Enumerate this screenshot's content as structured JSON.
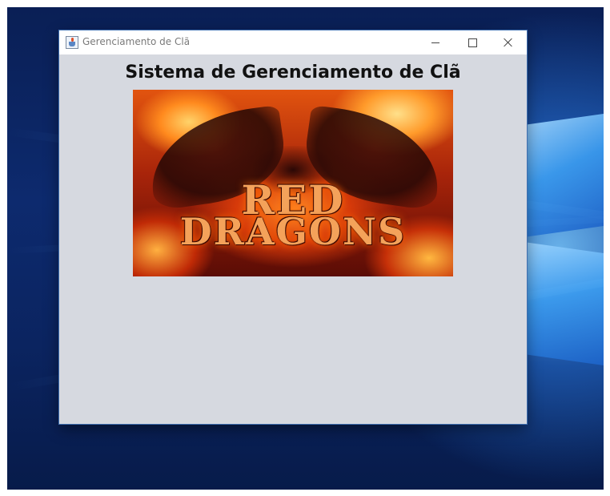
{
  "window": {
    "title": "Gerenciamento de Clã"
  },
  "main": {
    "heading": "Sistema de Gerenciamento de Clã",
    "banner": {
      "line1": "RED",
      "line2": "DRAGONS"
    }
  },
  "icons": {
    "app": "java-cup-icon",
    "minimize": "minimize-icon",
    "maximize": "maximize-icon",
    "close": "close-icon"
  }
}
